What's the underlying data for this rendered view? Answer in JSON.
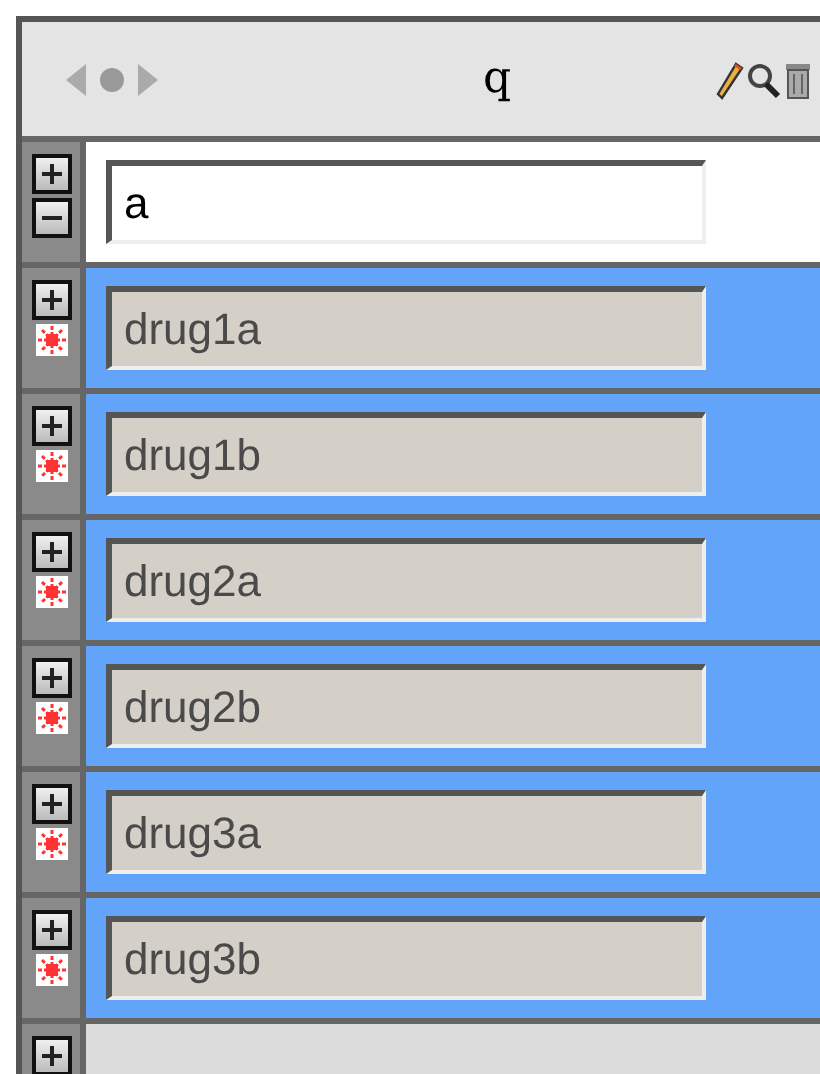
{
  "header": {
    "title": "q"
  },
  "query_row": {
    "value": "a",
    "disabled": false
  },
  "rows": [
    {
      "value": "drug1a",
      "disabled": true,
      "highlighted": true
    },
    {
      "value": "drug1b",
      "disabled": true,
      "highlighted": true
    },
    {
      "value": "drug2a",
      "disabled": true,
      "highlighted": true
    },
    {
      "value": "drug2b",
      "disabled": true,
      "highlighted": true
    },
    {
      "value": "drug3a",
      "disabled": true,
      "highlighted": true
    },
    {
      "value": "drug3b",
      "disabled": true,
      "highlighted": true
    }
  ]
}
